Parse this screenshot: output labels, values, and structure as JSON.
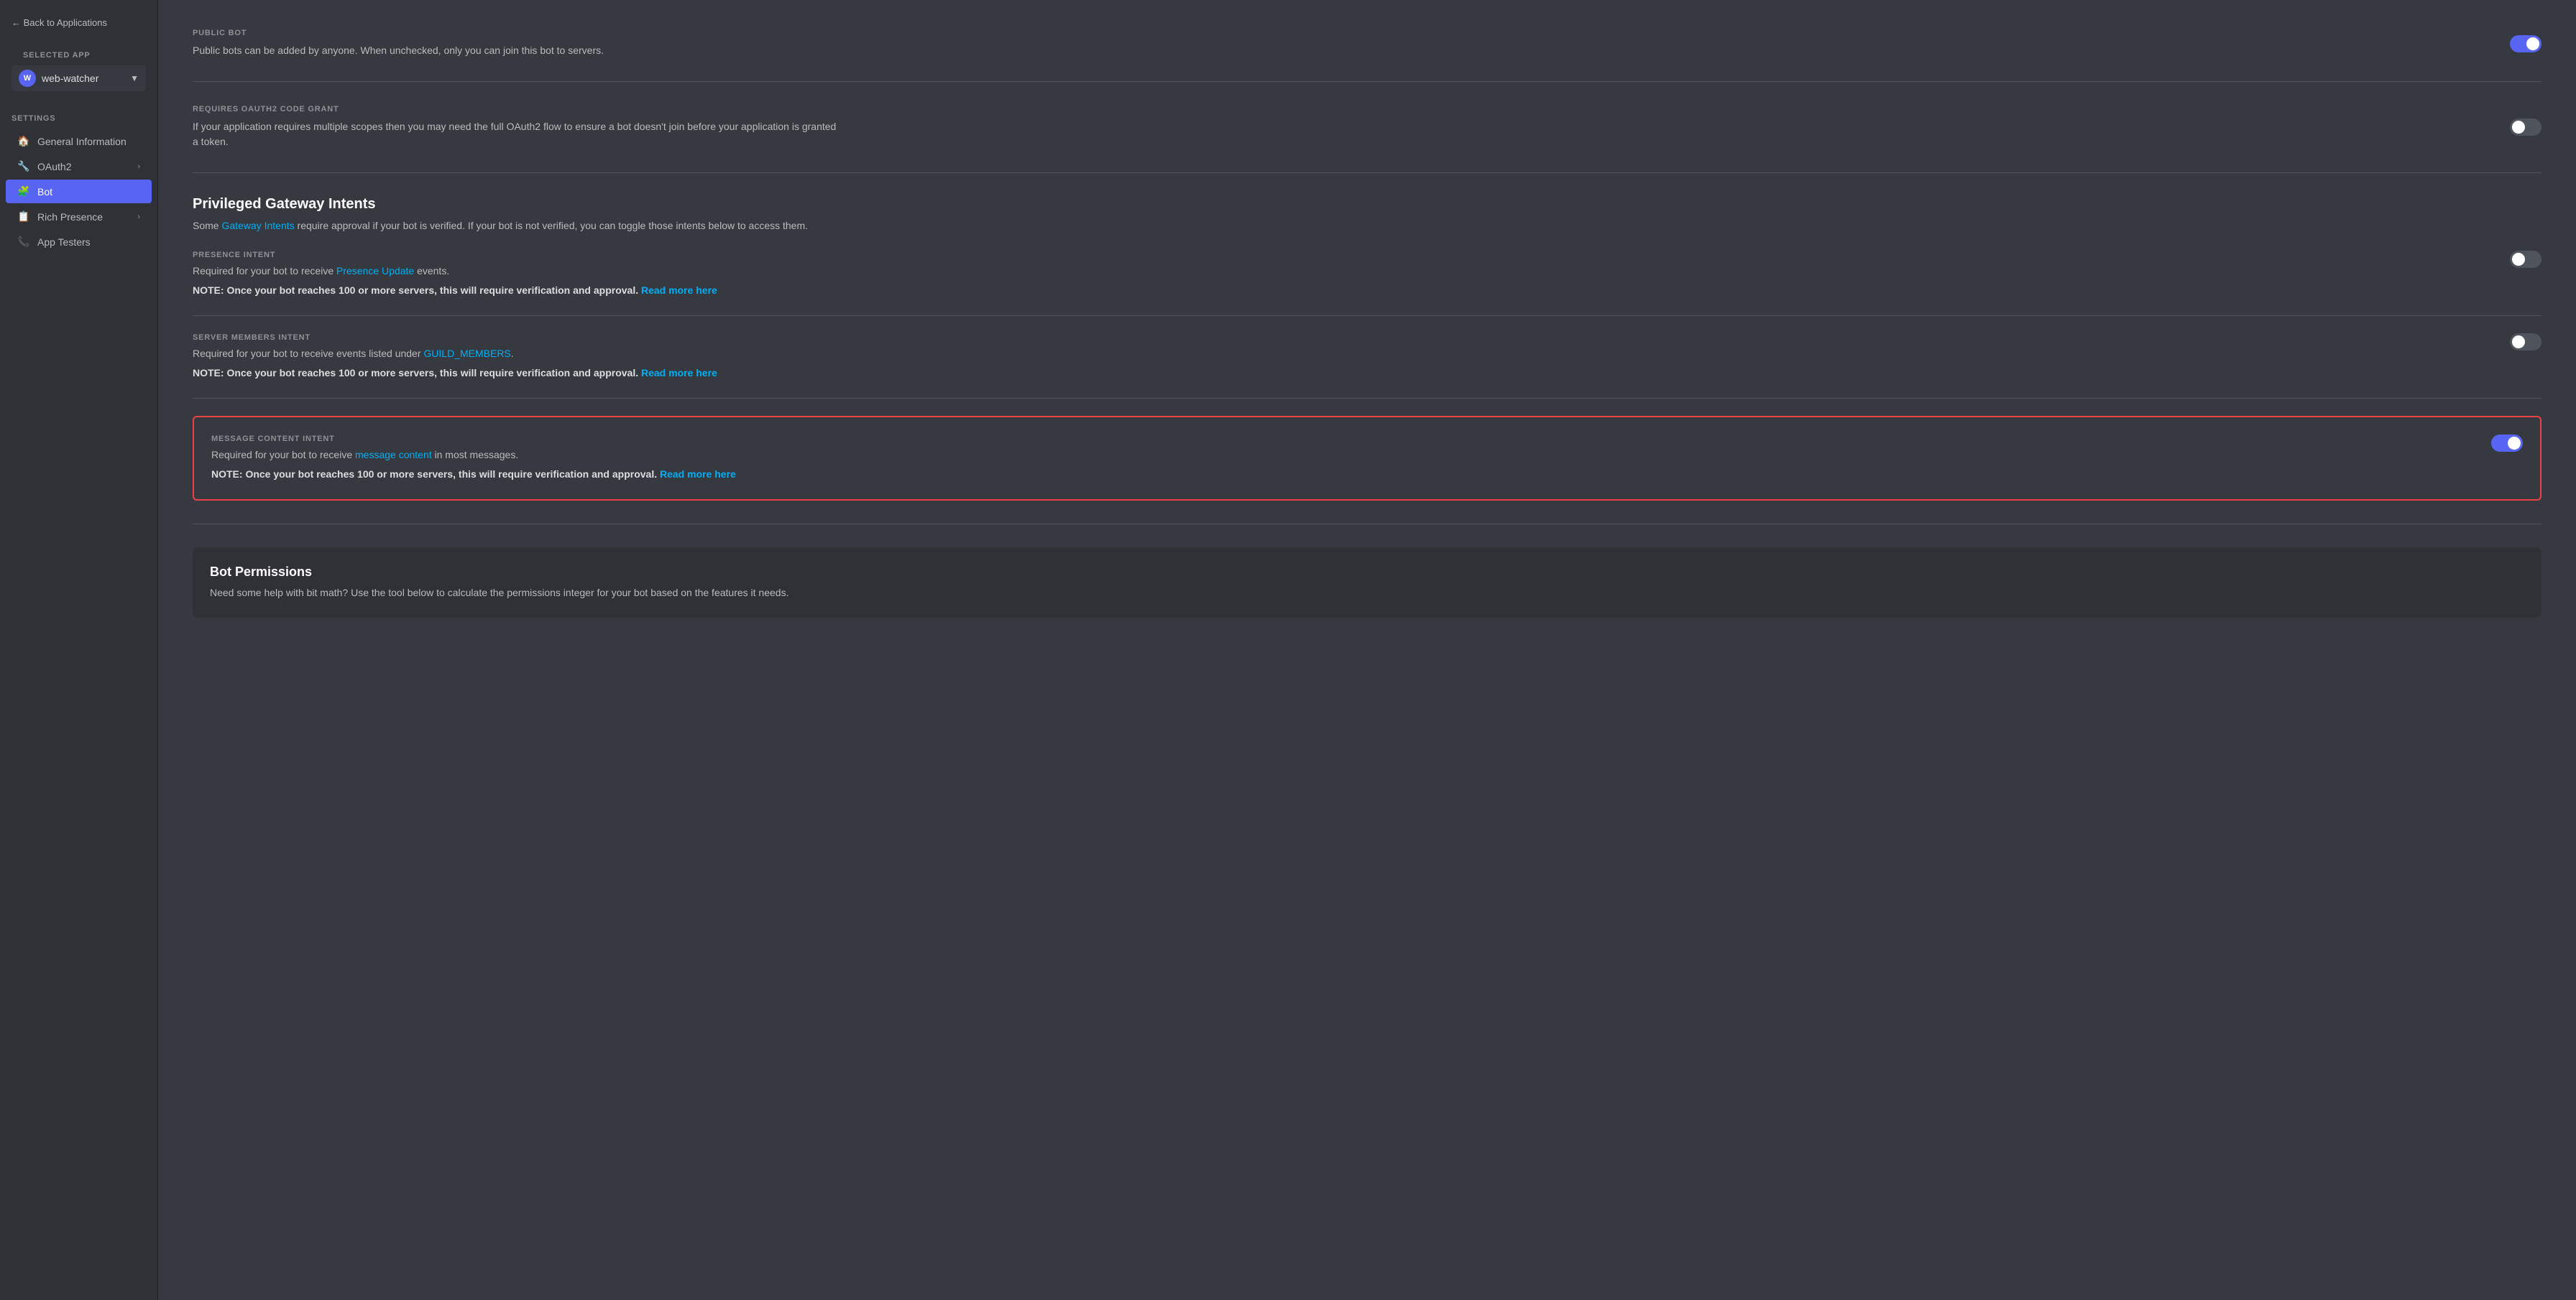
{
  "sidebar": {
    "back_label": "← Back to Applications",
    "selected_app_label": "SELECTED APP",
    "app_name": "web-watcher",
    "app_avatar_initials": "W",
    "settings_label": "SETTINGS",
    "nav_items": [
      {
        "id": "general-information",
        "label": "General Information",
        "icon": "🏠",
        "has_chevron": false,
        "active": false
      },
      {
        "id": "oauth2",
        "label": "OAuth2",
        "icon": "🔧",
        "has_chevron": true,
        "active": false
      },
      {
        "id": "bot",
        "label": "Bot",
        "icon": "🧩",
        "has_chevron": false,
        "active": true
      },
      {
        "id": "rich-presence",
        "label": "Rich Presence",
        "icon": "📋",
        "has_chevron": true,
        "active": false
      },
      {
        "id": "app-testers",
        "label": "App Testers",
        "icon": "📞",
        "has_chevron": false,
        "active": false
      }
    ]
  },
  "main": {
    "public_bot": {
      "label": "PUBLIC BOT",
      "description": "Public bots can be added by anyone. When unchecked, only you can join this bot to servers.",
      "toggle_on": true
    },
    "oauth2_code_grant": {
      "label": "REQUIRES OAUTH2 CODE GRANT",
      "description": "If your application requires multiple scopes then you may need the full OAuth2 flow to ensure a bot doesn't join before your application is granted a token.",
      "toggle_on": false
    },
    "privileged_gateway": {
      "title": "Privileged Gateway Intents",
      "description_prefix": "Some ",
      "link_text": "Gateway Intents",
      "description_suffix": " require approval if your bot is verified. If your bot is not verified, you can toggle those intents below to access them.",
      "intents": [
        {
          "id": "presence-intent",
          "label": "PRESENCE INTENT",
          "description_prefix": "Required for your bot to receive ",
          "link_text": "Presence Update",
          "description_suffix": " events.",
          "note_prefix": "NOTE: Once your bot reaches 100 or more servers, this will require verification and approval. ",
          "note_link": "Read more here",
          "toggle_on": false,
          "highlighted": false
        },
        {
          "id": "server-members-intent",
          "label": "SERVER MEMBERS INTENT",
          "description_prefix": "Required for your bot to receive events listed under ",
          "link_text": "GUILD_MEMBERS",
          "description_suffix": ".",
          "note_prefix": "NOTE: Once your bot reaches 100 or more servers, this will require verification and approval. ",
          "note_link": "Read more here",
          "toggle_on": false,
          "highlighted": false
        },
        {
          "id": "message-content-intent",
          "label": "MESSAGE CONTENT INTENT",
          "description_prefix": "Required for your bot to receive ",
          "link_text": "message content",
          "description_suffix": " in most messages.",
          "note_prefix": "NOTE: Once your bot reaches 100 or more servers, this will require verification and approval. ",
          "note_link": "Read more here",
          "toggle_on": true,
          "highlighted": true
        }
      ]
    },
    "bot_permissions": {
      "title": "Bot Permissions",
      "description": "Need some help with bit math? Use the tool below to calculate the permissions integer for your bot based on the features it needs."
    }
  }
}
